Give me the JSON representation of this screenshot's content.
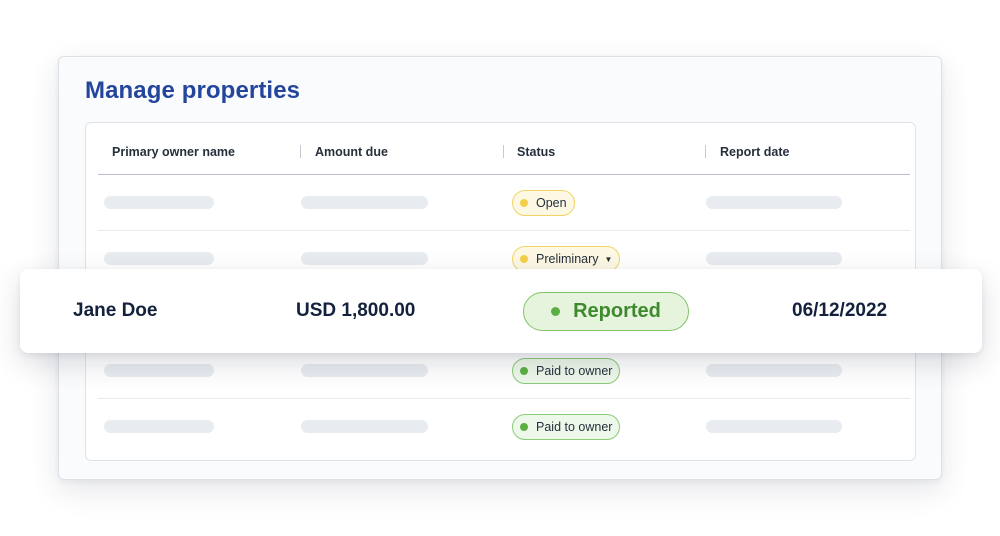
{
  "page_title": "Manage properties",
  "columns": [
    "Primary owner name",
    "Amount due",
    "Status",
    "Report date"
  ],
  "rows": [
    {
      "status": "Open",
      "status_color": "yellow",
      "has_dropdown": false
    },
    {
      "status": "Preliminary",
      "status_color": "yellow",
      "has_dropdown": true
    },
    {
      "status": "Paid to owner",
      "status_color": "green",
      "has_dropdown": false
    },
    {
      "status": "Paid to owner",
      "status_color": "green",
      "has_dropdown": false
    }
  ],
  "highlight": {
    "owner_name": "Jane Doe",
    "amount_due": "USD 1,800.00",
    "status": "Reported",
    "report_date": "06/12/2022"
  },
  "colors": {
    "title": "#23459c",
    "status_yellow_dot": "#f2cf4a",
    "status_green_dot": "#5cb043",
    "status_green_text": "#3f8a2e"
  },
  "icons": {
    "dropdown_caret": "▼"
  }
}
